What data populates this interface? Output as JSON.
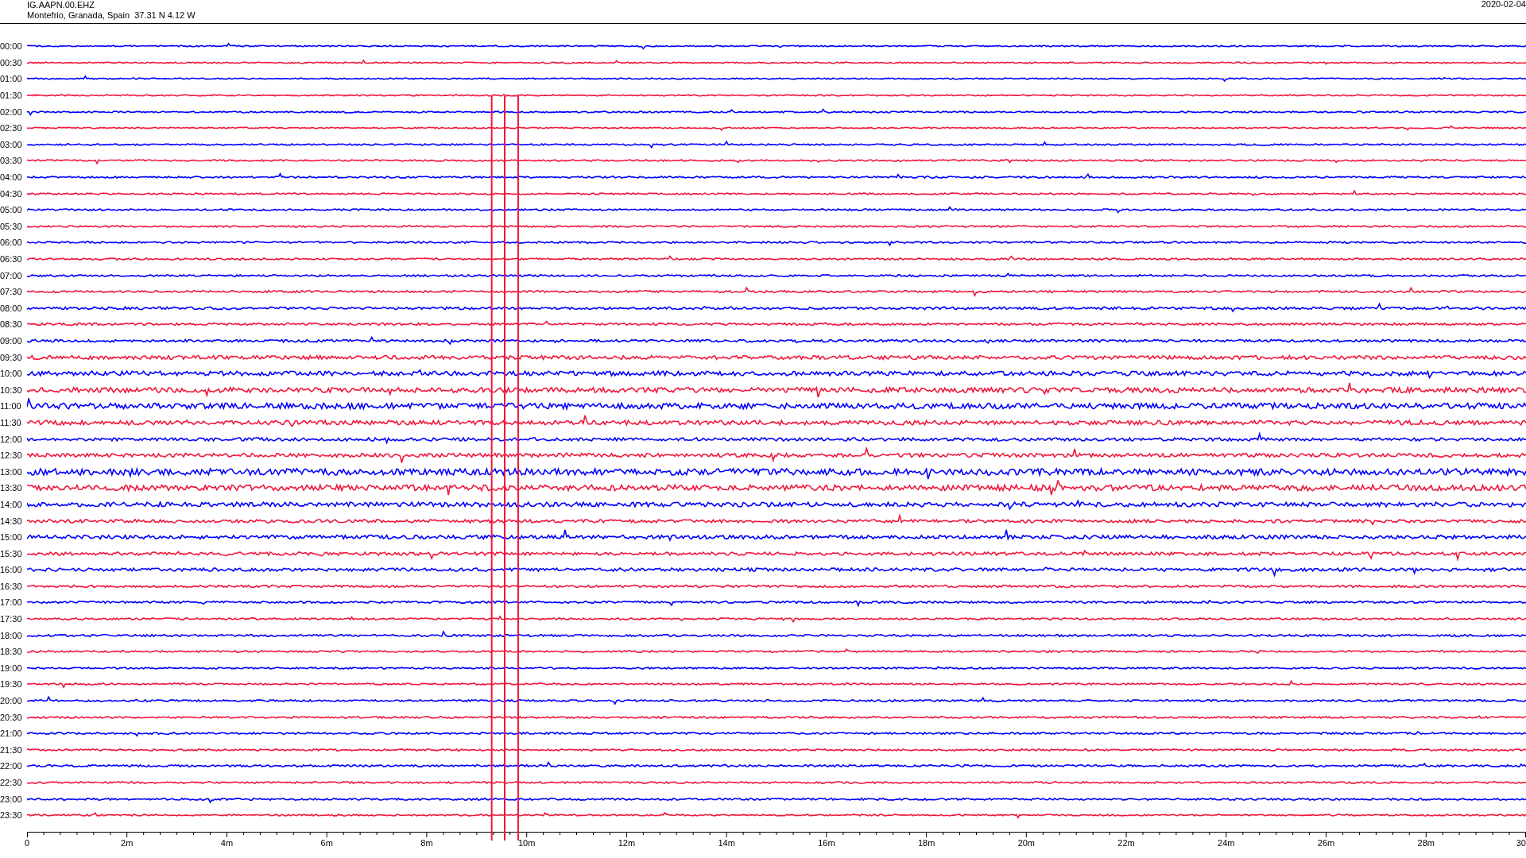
{
  "header": {
    "station": "IG.AAPN.00.EHZ",
    "location": "Montefrio, Granada, Spain  37.31 N 4.12 W",
    "date": "2020-02-04"
  },
  "rows": [
    {
      "label": "00:00",
      "color": "#0000ff"
    },
    {
      "label": "00:30",
      "color": "#f0183c"
    },
    {
      "label": "01:00",
      "color": "#0000ff"
    },
    {
      "label": "01:30",
      "color": "#f0183c"
    },
    {
      "label": "02:00",
      "color": "#0000ff"
    },
    {
      "label": "02:30",
      "color": "#f0183c"
    },
    {
      "label": "03:00",
      "color": "#0000ff"
    },
    {
      "label": "03:30",
      "color": "#f0183c"
    },
    {
      "label": "04:00",
      "color": "#0000ff"
    },
    {
      "label": "04:30",
      "color": "#f0183c"
    },
    {
      "label": "05:00",
      "color": "#0000ff"
    },
    {
      "label": "05:30",
      "color": "#f0183c"
    },
    {
      "label": "06:00",
      "color": "#0000ff"
    },
    {
      "label": "06:30",
      "color": "#f0183c"
    },
    {
      "label": "07:00",
      "color": "#0000ff"
    },
    {
      "label": "07:30",
      "color": "#f0183c"
    },
    {
      "label": "08:00",
      "color": "#0000ff"
    },
    {
      "label": "08:30",
      "color": "#f0183c"
    },
    {
      "label": "09:00",
      "color": "#0000ff"
    },
    {
      "label": "09:30",
      "color": "#f0183c"
    },
    {
      "label": "10:00",
      "color": "#0000ff"
    },
    {
      "label": "10:30",
      "color": "#f0183c"
    },
    {
      "label": "11:00",
      "color": "#0000ff"
    },
    {
      "label": "11:30",
      "color": "#f0183c"
    },
    {
      "label": "12:00",
      "color": "#0000ff"
    },
    {
      "label": "12:30",
      "color": "#f0183c"
    },
    {
      "label": "13:00",
      "color": "#0000ff"
    },
    {
      "label": "13:30",
      "color": "#f0183c"
    },
    {
      "label": "14:00",
      "color": "#0000ff"
    },
    {
      "label": "14:30",
      "color": "#f0183c"
    },
    {
      "label": "15:00",
      "color": "#0000ff"
    },
    {
      "label": "15:30",
      "color": "#f0183c"
    },
    {
      "label": "16:00",
      "color": "#0000ff"
    },
    {
      "label": "16:30",
      "color": "#f0183c"
    },
    {
      "label": "17:00",
      "color": "#0000ff"
    },
    {
      "label": "17:30",
      "color": "#f0183c"
    },
    {
      "label": "18:00",
      "color": "#0000ff"
    },
    {
      "label": "18:30",
      "color": "#f0183c"
    },
    {
      "label": "19:00",
      "color": "#0000ff"
    },
    {
      "label": "19:30",
      "color": "#f0183c"
    },
    {
      "label": "20:00",
      "color": "#0000ff"
    },
    {
      "label": "20:30",
      "color": "#f0183c"
    },
    {
      "label": "21:00",
      "color": "#0000ff"
    },
    {
      "label": "21:30",
      "color": "#f0183c"
    },
    {
      "label": "22:00",
      "color": "#0000ff"
    },
    {
      "label": "22:30",
      "color": "#f0183c"
    },
    {
      "label": "23:00",
      "color": "#0000ff"
    },
    {
      "label": "23:30",
      "color": "#f0183c"
    }
  ],
  "x_axis": {
    "labels": [
      "0",
      "2m",
      "4m",
      "6m",
      "8m",
      "10m",
      "12m",
      "14m",
      "16m",
      "18m",
      "20m",
      "22m",
      "24m",
      "26m",
      "28m",
      "30"
    ]
  }
}
